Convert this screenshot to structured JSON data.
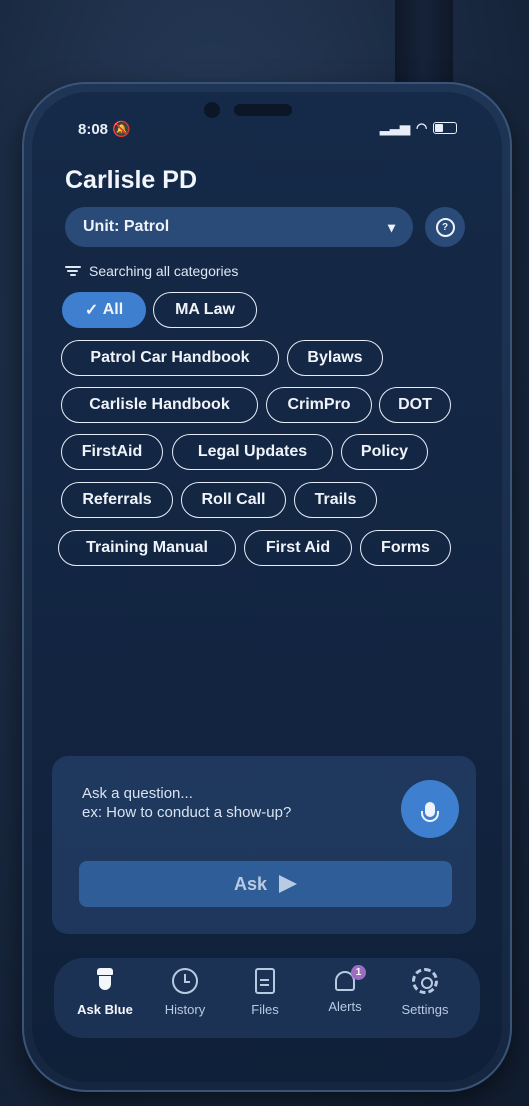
{
  "status_bar": {
    "time": "8:08"
  },
  "header": {
    "title": "Carlisle PD"
  },
  "unit_select": {
    "label": "Unit: Patrol"
  },
  "search": {
    "status_text": "Searching all categories"
  },
  "categories": [
    "All",
    "MA Law",
    "Patrol Car Handbook",
    "Bylaws",
    "Carlisle Handbook",
    "CrimPro",
    "DOT",
    "FirstAid",
    "Legal Updates",
    "Policy",
    "Referrals",
    "Roll Call",
    "Trails",
    "Training Manual",
    "First Aid",
    "Forms"
  ],
  "selected_category": "All",
  "ask": {
    "placeholder_line1": "Ask a question...",
    "placeholder_line2": "ex: How to conduct a show-up?",
    "button_label": "Ask"
  },
  "tabs": [
    {
      "label": "Ask Blue",
      "icon": "officer-icon",
      "active": true
    },
    {
      "label": "History",
      "icon": "clock-icon",
      "active": false
    },
    {
      "label": "Files",
      "icon": "file-icon",
      "active": false
    },
    {
      "label": "Alerts",
      "icon": "bell-icon",
      "active": false,
      "badge": "1"
    },
    {
      "label": "Settings",
      "icon": "gear-icon",
      "active": false
    }
  ],
  "colors": {
    "accent": "#3f7fd0",
    "background": "#122440",
    "badge": "#9c6ec0"
  }
}
